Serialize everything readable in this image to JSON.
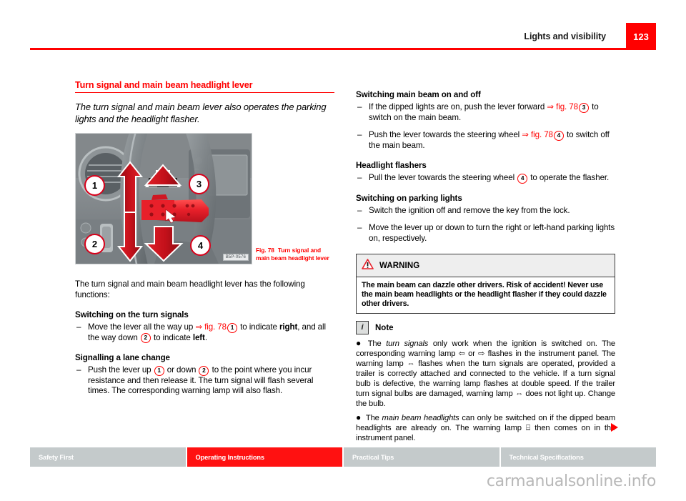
{
  "header": {
    "title": "Lights and visibility",
    "page_number": "123"
  },
  "left_column": {
    "section_title": "Turn signal and main beam headlight lever",
    "lead": "The turn signal and main beam lever also operates the parking lights and the headlight flasher.",
    "figure": {
      "caption_label": "Fig. 78",
      "caption_text": "Turn signal and main beam headlight lever",
      "image_code": "B5P-0576",
      "callouts": [
        "1",
        "2",
        "3",
        "4"
      ]
    },
    "intro": "The turn signal and main beam headlight lever has the following functions:",
    "blocks": [
      {
        "heading": "Switching on the turn signals",
        "items": [
          {
            "parts": [
              {
                "t": "text",
                "v": "Move the lever all the way up "
              },
              {
                "t": "xref",
                "v": "⇒ fig. 78"
              },
              {
                "t": "cnum",
                "v": "1"
              },
              {
                "t": "text",
                "v": " to indicate "
              },
              {
                "t": "bold",
                "v": "right"
              },
              {
                "t": "text",
                "v": ", and all the way down "
              },
              {
                "t": "cnum",
                "v": "2"
              },
              {
                "t": "text",
                "v": " to indicate "
              },
              {
                "t": "bold",
                "v": "left"
              },
              {
                "t": "text",
                "v": "."
              }
            ]
          }
        ]
      },
      {
        "heading": "Signalling a lane change",
        "items": [
          {
            "parts": [
              {
                "t": "text",
                "v": "Push the lever up "
              },
              {
                "t": "cnum",
                "v": "1"
              },
              {
                "t": "text",
                "v": " or down "
              },
              {
                "t": "cnum",
                "v": "2"
              },
              {
                "t": "text",
                "v": " to the point where you incur resistance and then release it. The turn signal will flash several times. The corresponding warning lamp will also flash."
              }
            ]
          }
        ]
      }
    ]
  },
  "right_column": {
    "blocks": [
      {
        "heading": "Switching main beam on and off",
        "items": [
          {
            "parts": [
              {
                "t": "text",
                "v": "If the dipped lights are on, push the lever forward "
              },
              {
                "t": "xref",
                "v": "⇒ fig. 78"
              },
              {
                "t": "cnum",
                "v": "3"
              },
              {
                "t": "text",
                "v": " to switch on the main beam."
              }
            ]
          },
          {
            "parts": [
              {
                "t": "text",
                "v": "Push the lever towards the steering wheel "
              },
              {
                "t": "xref",
                "v": "⇒ fig. 78"
              },
              {
                "t": "cnum",
                "v": "4"
              },
              {
                "t": "text",
                "v": " to switch off the main beam."
              }
            ]
          }
        ]
      },
      {
        "heading": "Headlight flashers",
        "items": [
          {
            "parts": [
              {
                "t": "text",
                "v": "Pull the lever towards the steering wheel "
              },
              {
                "t": "cnum",
                "v": "4"
              },
              {
                "t": "text",
                "v": " to operate the flasher."
              }
            ]
          }
        ]
      },
      {
        "heading": "Switching on parking lights",
        "items": [
          {
            "parts": [
              {
                "t": "text",
                "v": "Switch the ignition off and remove the key from the lock."
              }
            ]
          },
          {
            "parts": [
              {
                "t": "text",
                "v": "Move the lever up or down to turn the right or left-hand parking lights on, respectively."
              }
            ]
          }
        ]
      }
    ],
    "warning": {
      "label": "WARNING",
      "icon": "warning-triangle-icon",
      "body": "The main beam can dazzle other drivers. Risk of accident! Never use the main beam headlights or the headlight flasher if they could dazzle other drivers."
    },
    "note": {
      "label": "Note",
      "icon": "info-icon",
      "bullets": [
        {
          "parts": [
            {
              "t": "text",
              "v": "The "
            },
            {
              "t": "italic",
              "v": "turn signals"
            },
            {
              "t": "text",
              "v": " only work when the ignition is switched on. The corresponding warning lamp "
            },
            {
              "t": "glyph",
              "v": "⇦"
            },
            {
              "t": "text",
              "v": " or "
            },
            {
              "t": "glyph",
              "v": "⇨"
            },
            {
              "t": "text",
              "v": " flashes in the instrument panel. The warning lamp "
            },
            {
              "t": "glyph",
              "v": "⇔"
            },
            {
              "t": "text",
              "v": " flashes when the turn signals are operated, provided a trailer is correctly attached and connected to the vehicle. If a turn signal bulb is defective, the warning lamp flashes at double speed. If the trailer turn signal bulbs are damaged, warning lamp "
            },
            {
              "t": "glyph",
              "v": "⇔"
            },
            {
              "t": "text",
              "v": " does not light up. Change the bulb."
            }
          ]
        },
        {
          "parts": [
            {
              "t": "text",
              "v": "The "
            },
            {
              "t": "italic",
              "v": "main beam headlights"
            },
            {
              "t": "text",
              "v": " can only be switched on if the dipped beam headlights are already on. The warning lamp "
            },
            {
              "t": "glyph",
              "v": "⌸"
            },
            {
              "t": "text",
              "v": " then comes on in the instrument panel."
            }
          ]
        }
      ]
    }
  },
  "footer": {
    "tabs": [
      {
        "label": "Safety First",
        "active": false
      },
      {
        "label": "Operating Instructions",
        "active": true
      },
      {
        "label": "Practical Tips",
        "active": false
      },
      {
        "label": "Technical Specifications",
        "active": false
      }
    ]
  },
  "watermark": "carmanualsonline.info",
  "colors": {
    "accent_red": "#ff0000",
    "footer_gray": "#c4cacb",
    "warning_header_bg": "#eeeeee"
  }
}
